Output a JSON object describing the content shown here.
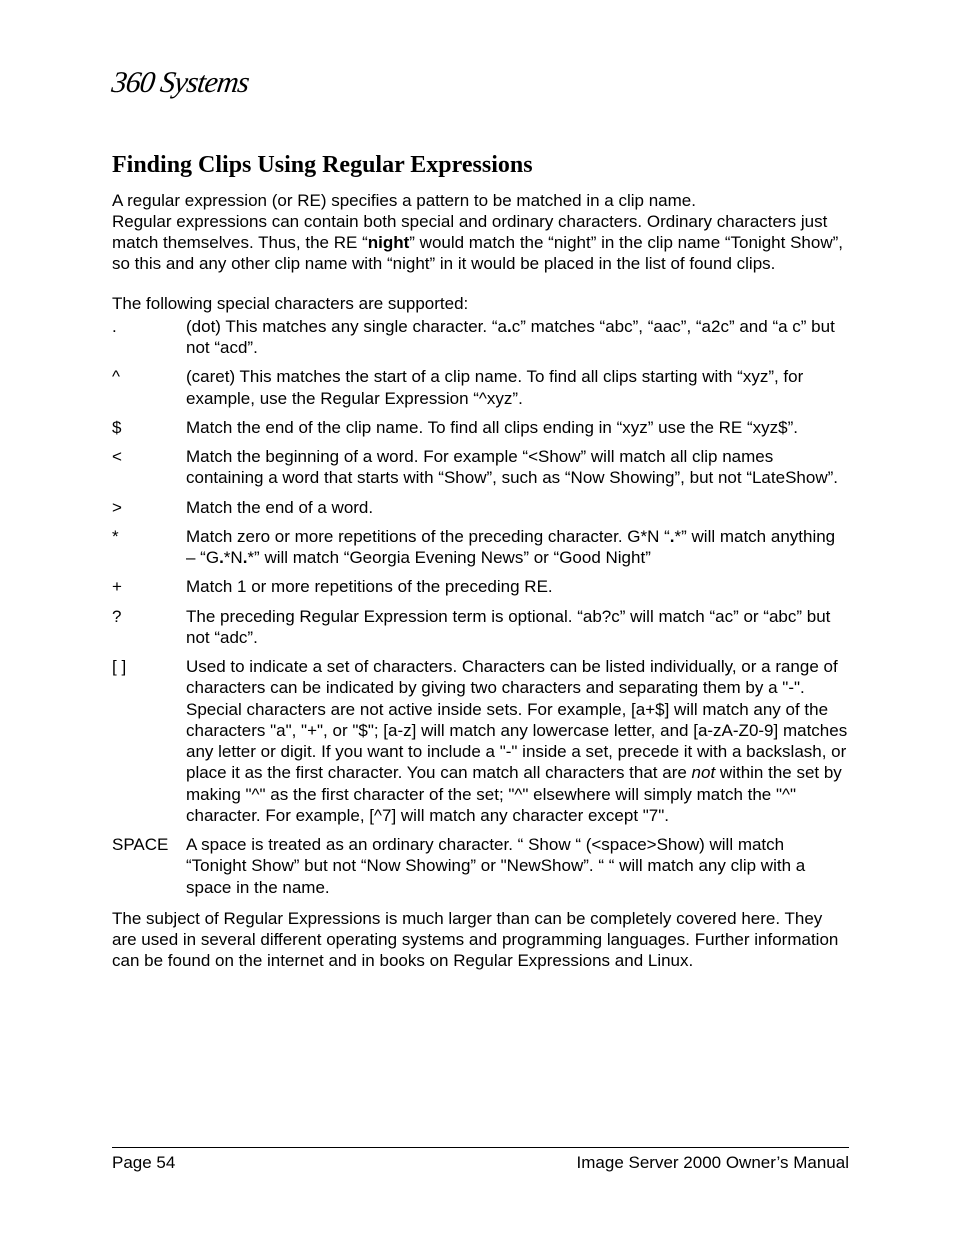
{
  "logo": "360 Systems",
  "title": "Finding Clips Using Regular Expressions",
  "intro_lines": [
    "A regular expression (or RE) specifies a pattern to be matched in a clip name.",
    "Regular expressions can contain both special and ordinary characters.  Ordinary characters just match themselves.  Thus, the RE “",
    "night",
    "” would match the “night” in the clip name “Tonight Show”, so this and any other clip name with “night” in it would be placed in the list of found clips."
  ],
  "lead_in": "The following special characters are supported:",
  "defs": [
    {
      "sym": ".",
      "pre": "(dot)  This matches any single character.  “a",
      "bold1": ".",
      "mid": "c” matches “abc”, “aac”, “a2c” and “a c” but not “acd”.",
      "bold2": "",
      "post": ""
    },
    {
      "sym": "^",
      "pre": "(caret) This matches the start of a clip name.  To find all clips starting with “xyz”, for example, use the Regular Expression “^xyz”.",
      "bold1": "",
      "mid": "",
      "bold2": "",
      "post": ""
    },
    {
      "sym": "$",
      "pre": "Match the end of the clip name.  To find all clips ending in “xyz” use the RE “xyz$”.",
      "bold1": "",
      "mid": "",
      "bold2": "",
      "post": ""
    },
    {
      "sym": "<",
      "pre": "Match the beginning of a word.  For example “<Show” will match all clip names containing a word that starts with “Show”, such as “Now Showing”, but not “LateShow”.",
      "bold1": "",
      "mid": "",
      "bold2": "",
      "post": ""
    },
    {
      "sym": ">",
      "pre": "Match the end of a word.",
      "bold1": "",
      "mid": "",
      "bold2": "",
      "post": ""
    },
    {
      "sym": "*",
      "pre": "Match zero or more repetitions of the preceding character. G*N “",
      "bold1": ".",
      "mid": "*” will match anything – “G",
      "bold2": ".",
      "post": "*N",
      "bold3": ".",
      "post2": "*” will match “Georgia Evening News” or “Good Night”"
    },
    {
      "sym": "+",
      "pre": "Match 1 or more repetitions of the preceding RE.",
      "bold1": "",
      "mid": "",
      "bold2": "",
      "post": ""
    },
    {
      "sym": "?",
      "pre": "The preceding Regular Expression term is optional. “ab?c” will match “ac” or “abc” but not “adc”.",
      "bold1": "",
      "mid": "",
      "bold2": "",
      "post": ""
    },
    {
      "sym": "[ ]",
      "pre": "Used to indicate a set of characters. Characters can be listed individually, or a range of characters can be indicated by giving two characters and separating them by a \"-\". Special characters are not active inside sets. For example, [a+$] will match any of the characters \"a\", \"+\", or \"$\"; [a-z] will match any lowercase letter, and [a-zA-Z0-9] matches any letter or digit.  If you want to include a \"-\" inside a set, precede it with a backslash, or place it as the first character. You can match all characters that are ",
      "italic": "not",
      "mid": " within the set by making \"^\" as the first character of the set; \"^\" elsewhere will simply match the \"^\" character. For example, [^7] will match any character except \"7\".",
      "bold1": "",
      "bold2": "",
      "post": ""
    },
    {
      "sym": "SPACE",
      "pre": "A space is treated as an ordinary character.  “ Show “ (<space>Show) will match “Tonight Show” but not “Now Showing” or \"NewShow”. “ “ will match any clip with a space in the name.",
      "bold1": "",
      "mid": "",
      "bold2": "",
      "post": ""
    }
  ],
  "outro": "The subject of Regular Expressions is much larger than can be completely covered here.  They are used in several different operating systems and programming languages.  Further information can be found on the internet and in books on Regular Expressions and Linux.",
  "footer": {
    "left": "Page 54",
    "right": "Image Server 2000 Owner’s Manual"
  }
}
